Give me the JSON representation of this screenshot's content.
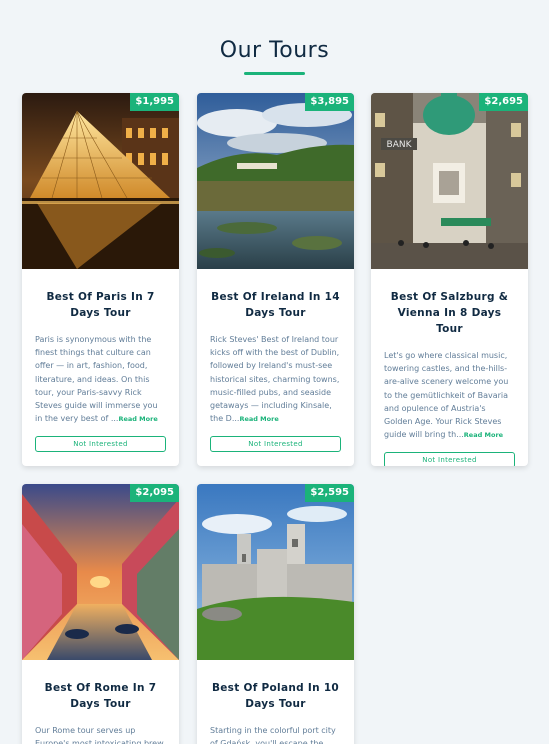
{
  "page": {
    "title": "Our Tours"
  },
  "colors": {
    "accent": "#1bb37a",
    "text": "#102a42",
    "muted": "#617d98",
    "background": "#f1f5f8"
  },
  "tours": [
    {
      "price": "$1,995",
      "name": "Best Of Paris In 7 Days Tour",
      "description": "Paris is synonymous with the finest things that culture can offer — in art, fashion, food, literature, and ideas. On this tour, your Paris-savvy Rick Steves guide will immerse you in the very best of ...",
      "read_more": "Read More",
      "not_interested": "Not Interested",
      "image": "louvre-pyramid-photo"
    },
    {
      "price": "$3,895",
      "name": "Best Of Ireland In 14 Days Tour",
      "description": "Rick Steves' Best of Ireland tour kicks off with the best of Dublin, followed by Ireland's must-see historical sites, charming towns, music-filled pubs, and seaside getaways — including Kinsale, the D...",
      "read_more": "Read More",
      "not_interested": "Not Interested",
      "image": "irish-landscape-photo"
    },
    {
      "price": "$2,695",
      "name": "Best Of Salzburg & Vienna In 8 Days Tour",
      "description": "Let's go where classical music, towering castles, and the-hills-are-alive scenery welcome you to the gemütlichkeit of Bavaria and opulence of Austria's Golden Age. Your Rick Steves guide will bring th...",
      "read_more": "Read More",
      "not_interested": "Not Interested",
      "image": "vienna-street-photo"
    },
    {
      "price": "$2,095",
      "name": "Best Of Rome In 7 Days Tour",
      "description": "Our Rome tour serves up Europe's most intoxicating brew",
      "read_more": "",
      "not_interested": "",
      "image": "canal-sunset-photo"
    },
    {
      "price": "$2,595",
      "name": "Best Of Poland In 10 Days Tour",
      "description": "Starting in the colorful port city of Gdańsk, you'll escape the",
      "read_more": "",
      "not_interested": "",
      "image": "castle-ruins-photo"
    }
  ]
}
